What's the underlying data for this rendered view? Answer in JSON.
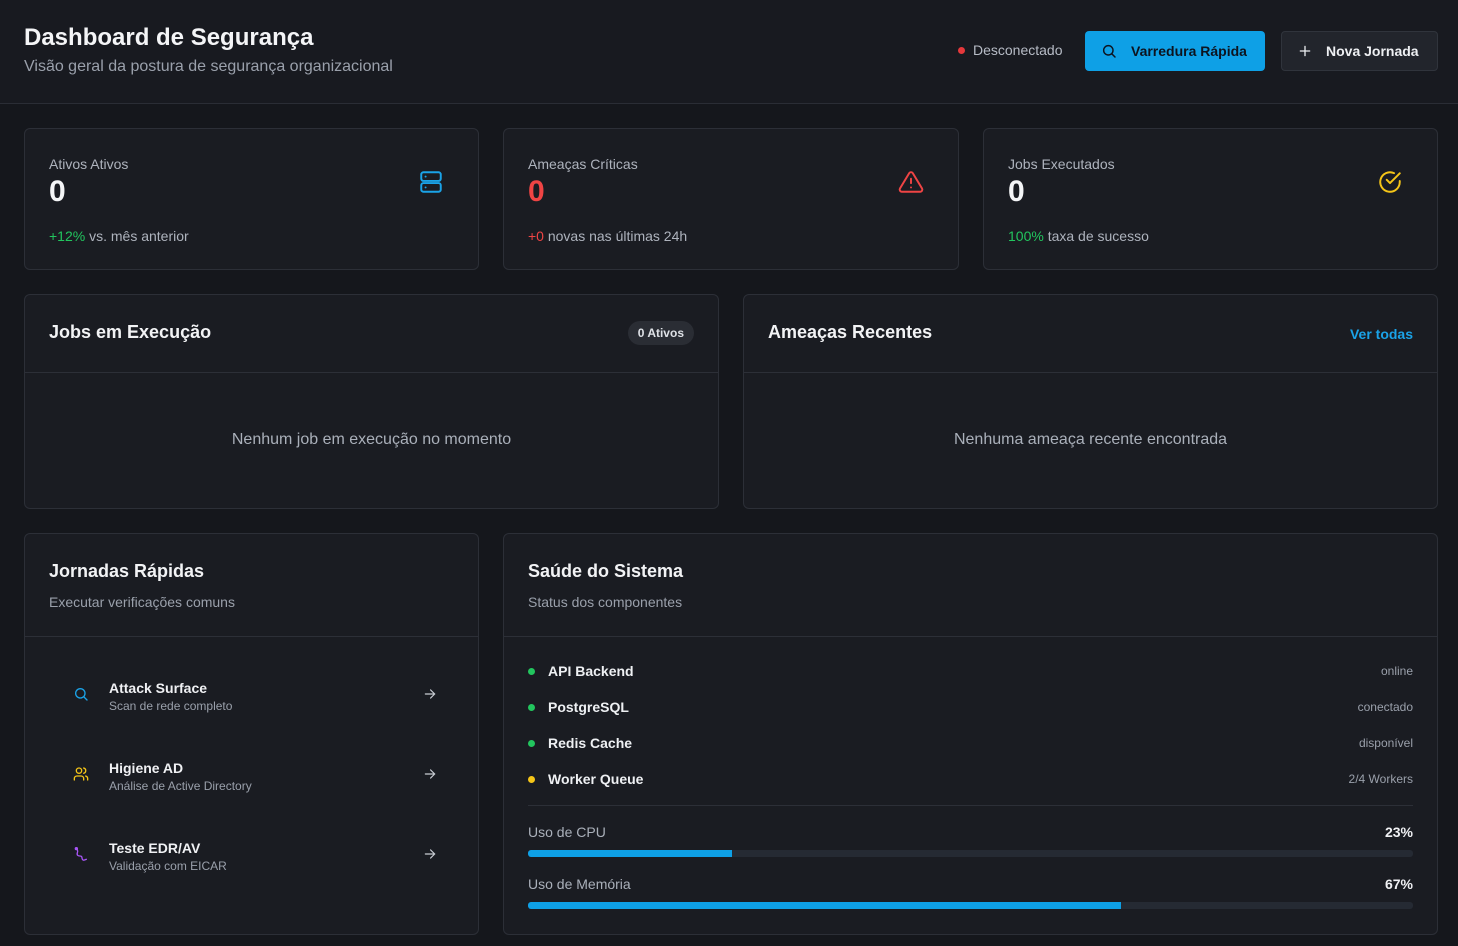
{
  "header": {
    "title": "Dashboard de Segurança",
    "subtitle": "Visão geral da postura de segurança organizacional",
    "connection_status": "Desconectado",
    "connection_color": "#e5383b",
    "quick_scan_label": "Varredura Rápida",
    "new_journey_label": "Nova Jornada"
  },
  "stats": [
    {
      "label": "Ativos Ativos",
      "value": "0",
      "delta": "+12%",
      "foot": "vs. mês anterior",
      "icon": "server-icon",
      "value_color": "#f4f5f7",
      "delta_color": "#22c55e",
      "icon_color": "#1aa3e8"
    },
    {
      "label": "Ameaças Críticas",
      "value": "0",
      "delta": "+0",
      "foot": "novas nas últimas 24h",
      "icon": "warning-triangle-icon",
      "value_color": "#ef4444",
      "delta_color": "#ef4444",
      "icon_color": "#ef4444"
    },
    {
      "label": "Jobs Executados",
      "value": "0",
      "delta": "100%",
      "foot": "taxa de sucesso",
      "icon": "check-circle-icon",
      "value_color": "#f4f5f7",
      "delta_color": "#22c55e",
      "icon_color": "#f5c518"
    }
  ],
  "jobs_panel": {
    "title": "Jobs em Execução",
    "badge": "0 Ativos",
    "empty_text": "Nenhum job em execução no momento"
  },
  "threats_panel": {
    "title": "Ameaças Recentes",
    "link": "Ver todas",
    "empty_text": "Nenhuma ameaça recente encontrada"
  },
  "journeys_panel": {
    "title": "Jornadas Rápidas",
    "subtitle": "Executar verificações comuns",
    "items": [
      {
        "title": "Attack Surface",
        "subtitle": "Scan de rede completo",
        "icon": "search-icon",
        "icon_color": "#1aa3e8"
      },
      {
        "title": "Higiene AD",
        "subtitle": "Análise de Active Directory",
        "icon": "users-icon",
        "icon_color": "#f5c518"
      },
      {
        "title": "Teste EDR/AV",
        "subtitle": "Validação com EICAR",
        "icon": "bug-icon",
        "icon_color": "#a855f7"
      }
    ]
  },
  "health_panel": {
    "title": "Saúde do Sistema",
    "subtitle": "Status dos componentes",
    "components": [
      {
        "name": "API Backend",
        "status": "online",
        "color": "#22c55e"
      },
      {
        "name": "PostgreSQL",
        "status": "conectado",
        "color": "#22c55e"
      },
      {
        "name": "Redis Cache",
        "status": "disponível",
        "color": "#22c55e"
      },
      {
        "name": "Worker Queue",
        "status": "2/4 Workers",
        "color": "#f5c518"
      }
    ],
    "metrics": [
      {
        "label": "Uso de CPU",
        "value": "23%",
        "fraction": 0.23
      },
      {
        "label": "Uso de Memória",
        "value": "67%",
        "fraction": 0.67
      }
    ]
  }
}
